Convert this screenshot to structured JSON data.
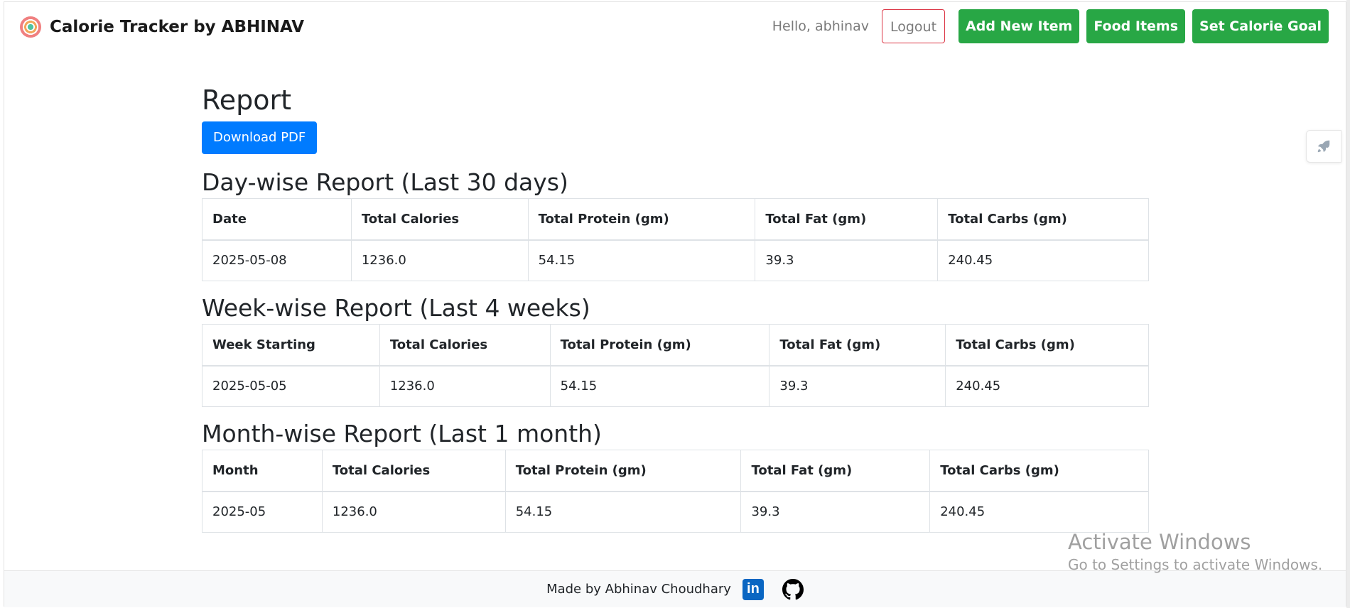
{
  "brand": {
    "name": "Calorie Tracker by ABHINAV"
  },
  "nav": {
    "greeting": "Hello, abhinav",
    "logout": "Logout",
    "add_item": "Add New Item",
    "food_items": "Food Items",
    "set_goal": "Set Calorie Goal"
  },
  "report": {
    "title": "Report",
    "download": "Download PDF"
  },
  "day_report": {
    "title": "Day-wise Report (Last 30 days)",
    "headers": [
      "Date",
      "Total Calories",
      "Total Protein (gm)",
      "Total Fat (gm)",
      "Total Carbs (gm)"
    ],
    "rows": [
      [
        "2025-05-08",
        "1236.0",
        "54.15",
        "39.3",
        "240.45"
      ]
    ]
  },
  "week_report": {
    "title": "Week-wise Report (Last 4 weeks)",
    "headers": [
      "Week Starting",
      "Total Calories",
      "Total Protein (gm)",
      "Total Fat (gm)",
      "Total Carbs (gm)"
    ],
    "rows": [
      [
        "2025-05-05",
        "1236.0",
        "54.15",
        "39.3",
        "240.45"
      ]
    ]
  },
  "month_report": {
    "title": "Month-wise Report (Last 1 month)",
    "headers": [
      "Month",
      "Total Calories",
      "Total Protein (gm)",
      "Total Fat (gm)",
      "Total Carbs (gm)"
    ],
    "rows": [
      [
        "2025-05",
        "1236.0",
        "54.15",
        "39.3",
        "240.45"
      ]
    ]
  },
  "footer": {
    "text": "Made by Abhinav Choudhary"
  },
  "watermark": {
    "title": "Activate Windows",
    "subtitle": "Go to Settings to activate Windows."
  },
  "colors": {
    "primary": "#007bff",
    "success": "#28a745",
    "danger": "#dc3545",
    "linkedin": "#0a66c2"
  },
  "icons": {
    "brand": "calorie-ring-icon",
    "linkedin": "linkedin-icon",
    "github": "github-icon",
    "side": "rocket-icon"
  }
}
